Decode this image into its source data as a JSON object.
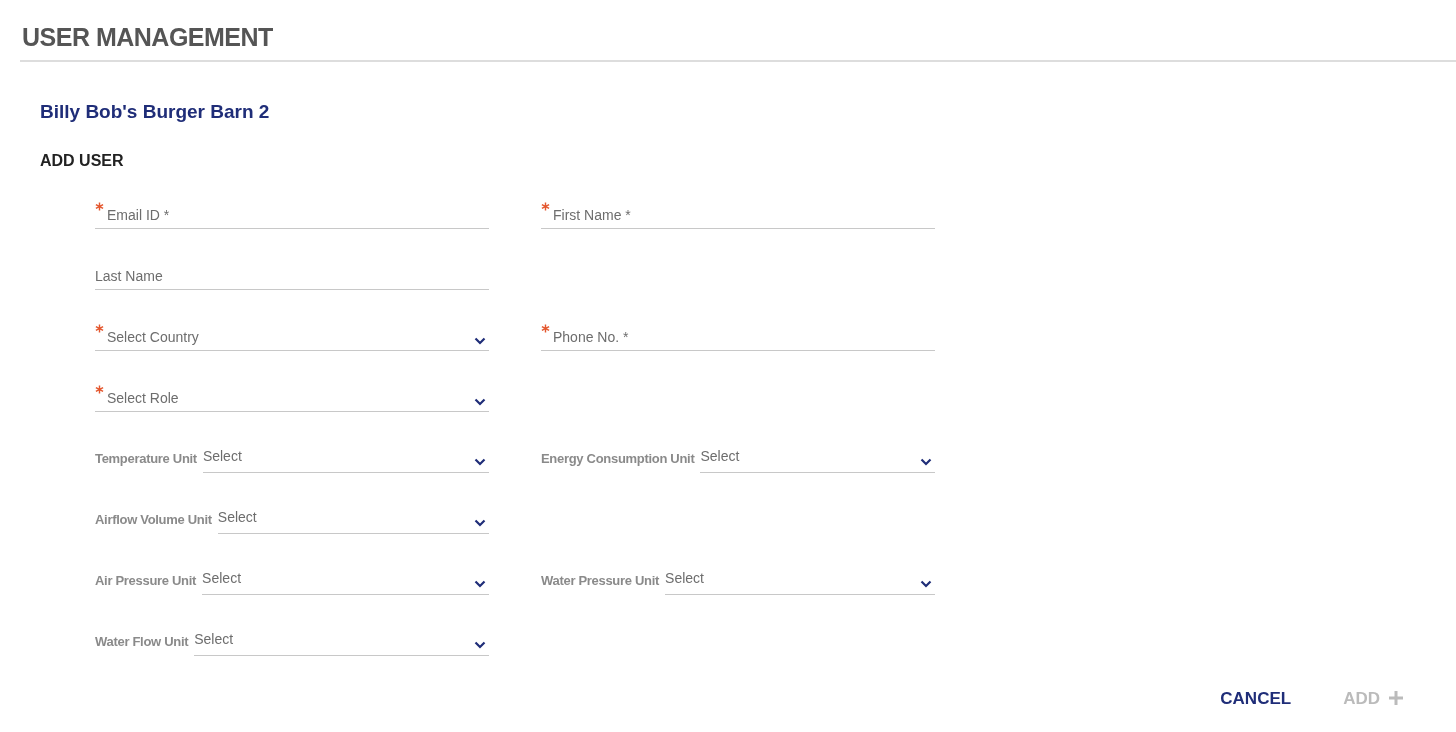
{
  "page_title": "USER MANAGEMENT",
  "site_name": "Billy Bob's Burger Barn 2",
  "form": {
    "title": "ADD USER",
    "rows": [
      [
        {
          "kind": "input",
          "placeholder": "Email ID *",
          "required": true
        },
        {
          "kind": "input",
          "placeholder": "First Name *",
          "required": true
        }
      ],
      [
        {
          "kind": "input",
          "placeholder": "Last Name",
          "required": false
        },
        null
      ],
      [
        {
          "kind": "dropdown",
          "placeholder": "Select Country",
          "required": true
        },
        {
          "kind": "input",
          "placeholder": "Phone No. *",
          "required": true
        }
      ],
      [
        {
          "kind": "dropdown",
          "placeholder": "Select Role",
          "required": true
        },
        null
      ],
      [
        {
          "kind": "unit",
          "label": "Temperature Unit",
          "value": "Select"
        },
        {
          "kind": "unit",
          "label": "Energy Consumption Unit",
          "value": "Select"
        }
      ],
      [
        {
          "kind": "unit",
          "label": "Airflow Volume Unit",
          "value": "Select"
        },
        null
      ],
      [
        {
          "kind": "unit",
          "label": "Air Pressure Unit",
          "value": "Select"
        },
        {
          "kind": "unit",
          "label": "Water Pressure Unit",
          "value": "Select"
        }
      ],
      [
        {
          "kind": "unit",
          "label": "Water Flow Unit",
          "value": "Select"
        },
        null
      ]
    ]
  },
  "buttons": [
    {
      "kind": "cancel",
      "label": "CANCEL",
      "disabled": false
    },
    {
      "kind": "add",
      "label": "ADD",
      "disabled": true
    }
  ]
}
